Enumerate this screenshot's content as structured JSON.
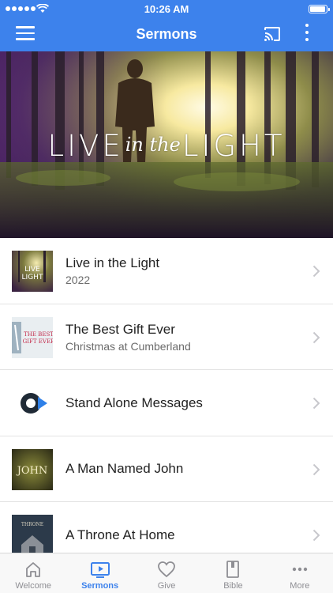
{
  "status_bar": {
    "time": "10:26 AM"
  },
  "nav": {
    "title": "Sermons"
  },
  "hero": {
    "title_left": "LIVE",
    "title_mid": "in the",
    "title_right": "LIGHT"
  },
  "sermons": [
    {
      "title": "Live in the Light",
      "subtitle": "2022",
      "thumb": "live-in-the-light-thumbnail"
    },
    {
      "title": "The Best Gift Ever",
      "subtitle": "Christmas at Cumberland",
      "thumb": "best-gift-ever-thumbnail"
    },
    {
      "title": "Stand Alone Messages",
      "subtitle": "",
      "thumb": "stand-alone-logo"
    },
    {
      "title": "A Man Named John",
      "subtitle": "",
      "thumb": "man-named-john-thumbnail"
    },
    {
      "title": "A Throne At Home",
      "subtitle": "",
      "thumb": "throne-at-home-thumbnail"
    }
  ],
  "tabs": [
    {
      "label": "Welcome",
      "icon": "home-icon",
      "active": false
    },
    {
      "label": "Sermons",
      "icon": "tv-play-icon",
      "active": true
    },
    {
      "label": "Give",
      "icon": "heart-icon",
      "active": false
    },
    {
      "label": "Bible",
      "icon": "book-icon",
      "active": false
    },
    {
      "label": "More",
      "icon": "ellipsis-icon",
      "active": false
    }
  ],
  "colors": {
    "accent": "#3d82ec",
    "tab_inactive": "#8e8e93"
  }
}
